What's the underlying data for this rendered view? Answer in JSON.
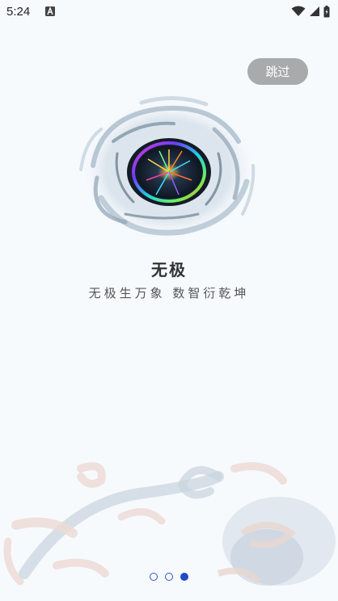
{
  "status_bar": {
    "time": "5:24",
    "icons": [
      "accessibility-a-icon",
      "wifi-icon",
      "signal-icon",
      "battery-icon"
    ]
  },
  "skip_button": {
    "label": "跳过"
  },
  "logo": {
    "icon": "swirl-eye-logo-icon"
  },
  "title": "无极",
  "slogan": "无极生万象  数智衍乾坤",
  "pager": {
    "count": 3,
    "active_index": 2
  },
  "colors": {
    "background": "#f7fafd",
    "skip_bg": "#a9aaab",
    "dot": "#2349c7"
  }
}
